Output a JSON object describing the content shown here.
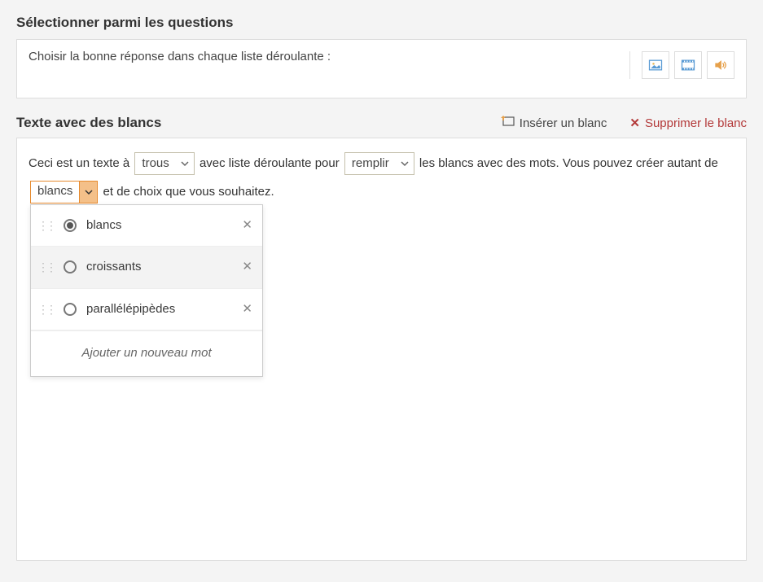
{
  "questionSection": {
    "header": "Sélectionner parmi les questions",
    "prompt": "Choisir la bonne réponse dans chaque liste déroulante :"
  },
  "blanksSection": {
    "header": "Texte avec des blancs",
    "actions": {
      "insert": "Insérer un blanc",
      "delete": "Supprimer le blanc"
    }
  },
  "editor": {
    "t1": "Ceci est un texte à",
    "t2": "avec liste déroulante pour",
    "t3": "les blancs avec des mots. Vous pouvez créer autant de",
    "t4": "et de choix que vous souhaitez."
  },
  "blanks": {
    "b1": {
      "value": "trous"
    },
    "b2": {
      "value": "remplir"
    },
    "b3": {
      "value": "blancs",
      "options": [
        {
          "label": "blancs",
          "selected": true
        },
        {
          "label": "croissants",
          "selected": false
        },
        {
          "label": "parallélépipèdes",
          "selected": false
        }
      ],
      "addLabel": "Ajouter un nouveau mot"
    }
  },
  "icons": {
    "image": "image-icon",
    "video": "video-icon",
    "audio": "audio-icon"
  }
}
